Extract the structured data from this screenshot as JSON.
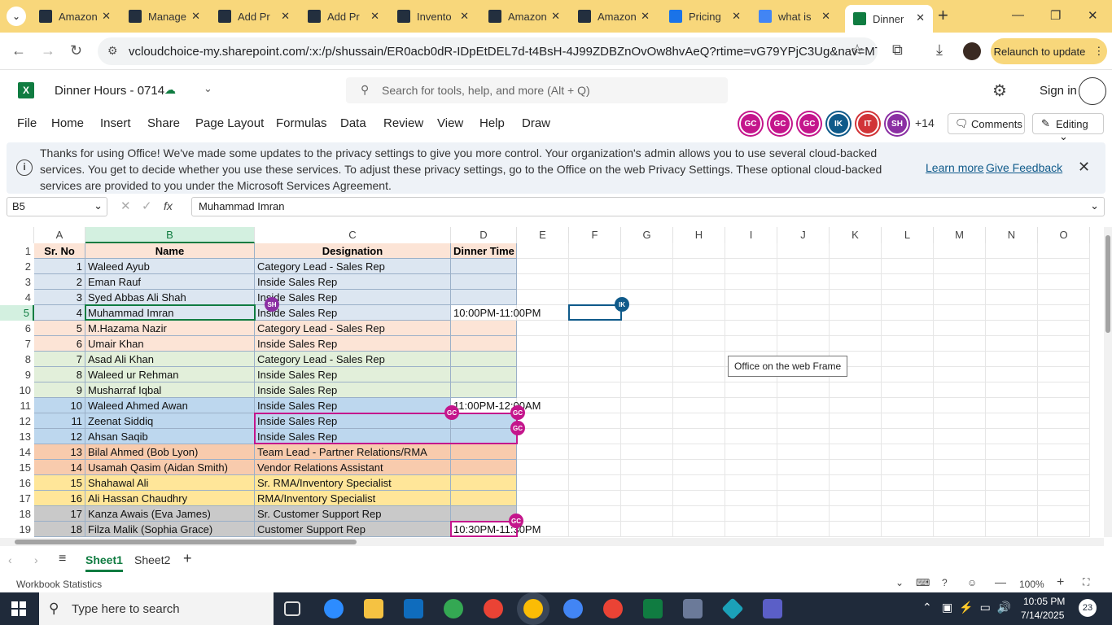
{
  "browser": {
    "tabs": [
      {
        "title": "Amazon",
        "icon": "amazon-icon",
        "color": "#232f3e"
      },
      {
        "title": "Manage",
        "icon": "amazon-icon",
        "color": "#232f3e"
      },
      {
        "title": "Add Pr",
        "icon": "amazon-icon",
        "color": "#232f3e"
      },
      {
        "title": "Add Pr",
        "icon": "amazon-icon",
        "color": "#232f3e"
      },
      {
        "title": "Invento",
        "icon": "amazon-icon",
        "color": "#232f3e"
      },
      {
        "title": "Amazon",
        "icon": "amazon-smile-icon",
        "color": "#232f3e"
      },
      {
        "title": "Amazon",
        "icon": "amazon-smile-icon",
        "color": "#232f3e"
      },
      {
        "title": "Pricing",
        "icon": "dollar-icon",
        "color": "#1a73e8"
      },
      {
        "title": "what is",
        "icon": "google-icon",
        "color": "#4285f4"
      },
      {
        "title": "Dinner",
        "icon": "excel-icon",
        "color": "#107c41"
      }
    ],
    "close_glyph": "✕",
    "new_tab_glyph": "+",
    "url": "vcloudchoice-my.sharepoint.com/:x:/p/shussain/ER0acb0dR-IDpEtDEL7d-t4BsH-4J99ZDBZnOvOw8hvAeQ?rtime=vG79YPjC3Ug&nav=MTVfe...",
    "relaunch": "Relaunch to update"
  },
  "excel": {
    "file_name": "Dinner Hours - 0714",
    "search_placeholder": "Search for tools, help, and more (Alt + Q)",
    "sign_in": "Sign in",
    "menu": [
      "File",
      "Home",
      "Insert",
      "Share",
      "Page Layout",
      "Formulas",
      "Data",
      "Review",
      "View",
      "Help",
      "Draw"
    ],
    "collaborators": [
      {
        "initials": "GC",
        "color": "#c4168c"
      },
      {
        "initials": "GC",
        "color": "#c4168c"
      },
      {
        "initials": "GC",
        "color": "#c4168c"
      },
      {
        "initials": "IK",
        "color": "#0f5a8a"
      },
      {
        "initials": "IT",
        "color": "#d13438"
      },
      {
        "initials": "SH",
        "color": "#8b2fa3"
      }
    ],
    "more_collaborators": "+14",
    "comments": "Comments",
    "editing": "Editing",
    "banner_text": "Thanks for using Office! We've made some updates to the privacy settings to give you more control. Your organization's admin allows you to use several cloud-backed services. You get to decide whether you use these services. To adjust these privacy settings, go to the Office on the web Privacy Settings. These optional cloud-backed services are provided to you under the Microsoft Services Agreement.",
    "learn_more": "Learn more",
    "give_feedback": "Give Feedback",
    "name_box": "B5",
    "fx": "fx",
    "formula_value": "Muhammad Imran",
    "columns": [
      "A",
      "B",
      "C",
      "D",
      "E",
      "F",
      "G",
      "H",
      "I",
      "J",
      "K",
      "L",
      "M",
      "N",
      "O"
    ],
    "header_row": [
      "Sr. No",
      "Name",
      "Designation",
      "Dinner Time"
    ],
    "rows": [
      {
        "n": "1",
        "name": "Waleed Ayub",
        "des": "Category Lead - Sales Rep",
        "time": "",
        "bg": "#dce6f1"
      },
      {
        "n": "2",
        "name": "Eman Rauf",
        "des": "Inside Sales Rep",
        "time": "",
        "bg": "#dce6f1"
      },
      {
        "n": "3",
        "name": "Syed Abbas Ali Shah",
        "des": "Inside Sales Rep",
        "time": "",
        "bg": "#dce6f1"
      },
      {
        "n": "4",
        "name": "Muhammad Imran",
        "des": "Inside Sales Rep",
        "time": "10:00PM-11:00PM",
        "bg": "#dce6f1"
      },
      {
        "n": "5",
        "name": "M.Hazama Nazir",
        "des": "Category Lead - Sales Rep",
        "time": "",
        "bg": "#fce4d6"
      },
      {
        "n": "6",
        "name": "Umair Khan",
        "des": "Inside Sales Rep",
        "time": "",
        "bg": "#fce4d6"
      },
      {
        "n": "7",
        "name": "Asad Ali Khan",
        "des": "Category Lead - Sales Rep",
        "time": "",
        "bg": "#e2efda"
      },
      {
        "n": "8",
        "name": "Waleed ur Rehman",
        "des": "Inside Sales Rep",
        "time": "",
        "bg": "#e2efda"
      },
      {
        "n": "9",
        "name": "Musharraf Iqbal",
        "des": "Inside Sales Rep",
        "time": "",
        "bg": "#e2efda"
      },
      {
        "n": "10",
        "name": "Waleed Ahmed Awan",
        "des": "Inside Sales Rep",
        "time": "11:00PM-12:00AM",
        "bg": "#bdd7ee"
      },
      {
        "n": "11",
        "name": "Zeenat Siddiq",
        "des": "Inside Sales Rep",
        "time": "",
        "bg": "#bdd7ee"
      },
      {
        "n": "12",
        "name": "Ahsan Saqib",
        "des": "Inside Sales Rep",
        "time": "",
        "bg": "#bdd7ee"
      },
      {
        "n": "13",
        "name": "Bilal Ahmed (Bob Lyon)",
        "des": "Team Lead - Partner Relations/RMA",
        "time": "",
        "bg": "#f8cbad"
      },
      {
        "n": "14",
        "name": "Usamah Qasim (Aidan Smith)",
        "des": "Vendor Relations Assistant",
        "time": "",
        "bg": "#f8cbad"
      },
      {
        "n": "15",
        "name": "Shahawal Ali",
        "des": "Sr. RMA/Inventory Specialist",
        "time": "",
        "bg": "#ffe699"
      },
      {
        "n": "16",
        "name": "Ali Hassan Chaudhry",
        "des": "RMA/Inventory Specialist",
        "time": "",
        "bg": "#ffe699"
      },
      {
        "n": "17",
        "name": "Kanza Awais (Eva James)",
        "des": "Sr. Customer Support Rep",
        "time": "",
        "bg": "#c9c9c9"
      },
      {
        "n": "18",
        "name": "Filza Malik (Sophia Grace)",
        "des": "Customer Support Rep",
        "time": "10:30PM-11:30PM",
        "bg": "#c9c9c9"
      }
    ],
    "tooltip": "Office on the web Frame",
    "presence_badges": [
      {
        "initials": "SH",
        "color": "#8b2fa3"
      },
      {
        "initials": "IK",
        "color": "#0f5a8a"
      },
      {
        "initials": "GC",
        "color": "#c4168c"
      },
      {
        "initials": "GC",
        "color": "#c4168c"
      },
      {
        "initials": "GC",
        "color": "#c4168c"
      },
      {
        "initials": "GC",
        "color": "#c4168c"
      }
    ],
    "sheets": [
      "Sheet1",
      "Sheet2"
    ],
    "status_left": "Workbook Statistics",
    "zoom": "100%"
  },
  "taskbar": {
    "search_placeholder": "Type here to search",
    "time": "10:05 PM",
    "date": "7/14/2025",
    "notifications": "23"
  }
}
